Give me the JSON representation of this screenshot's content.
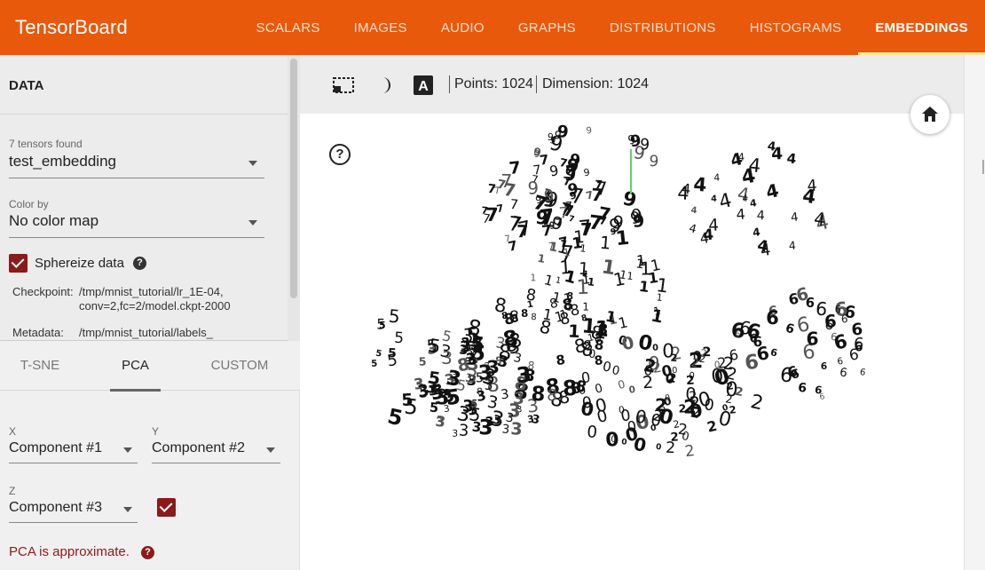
{
  "app": {
    "title": "TensorBoard"
  },
  "nav": {
    "tabs": [
      {
        "label": "SCALARS"
      },
      {
        "label": "IMAGES"
      },
      {
        "label": "AUDIO"
      },
      {
        "label": "GRAPHS"
      },
      {
        "label": "DISTRIBUTIONS"
      },
      {
        "label": "HISTOGRAMS"
      },
      {
        "label": "EMBEDDINGS",
        "active": true
      }
    ]
  },
  "data_panel": {
    "title": "DATA",
    "tensors_found": "7 tensors found",
    "tensor_selected": "test_embedding",
    "color_by_label": "Color by",
    "color_by_value": "No color map",
    "sphereize_label": "Sphereize data",
    "sphereize_checked": true,
    "checkpoint_key": "Checkpoint:",
    "checkpoint_line1": "/tmp/mnist_tutorial/lr_1E-04,",
    "checkpoint_line2": "conv=2,fc=2/model.ckpt-2000",
    "metadata_key": "Metadata:",
    "metadata_value": "/tmp/mnist_tutorial/labels_"
  },
  "projection": {
    "tabs": [
      {
        "label": "T-SNE"
      },
      {
        "label": "PCA",
        "active": true
      },
      {
        "label": "CUSTOM"
      }
    ],
    "x_label": "X",
    "x_value": "Component #1",
    "y_label": "Y",
    "y_value": "Component #2",
    "z_label": "Z",
    "z_value": "Component #3",
    "z_enabled": true,
    "note": "PCA is approximate."
  },
  "toolbar": {
    "points_text": "Points: 1024",
    "dimension_text": "Dimension: 1024",
    "icons": [
      "select-region-icon",
      "night-mode-icon",
      "label-toggle-icon"
    ]
  },
  "colors": {
    "header": "#e8590c",
    "checkbox": "#8b1a1a",
    "note": "#8b1a1a"
  }
}
